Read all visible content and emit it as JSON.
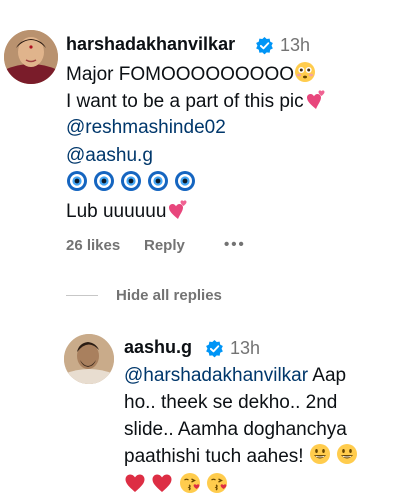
{
  "comment": {
    "username": "harshadakhanvilkar",
    "time": "13h",
    "line1": "Major FOMOOOOOOOOO",
    "line1_emoji": "flushed-face-icon",
    "line2": "I want to be a part of this pic",
    "line2_emoji": "two-hearts-icon",
    "mention1": "@reshmashinde02",
    "mention2": "@aashu.g",
    "line5_emoji": "nazar-amulet-icon x5",
    "line6": "Lub uuuuuu",
    "line6_emoji": "two-hearts-icon",
    "likes": "26 likes",
    "reply_label": "Reply",
    "more_label": "•••"
  },
  "replies_toggle": {
    "label": "Hide all replies"
  },
  "reply": {
    "username": "aashu.g",
    "time": "13h",
    "mention": "@harshadakhanvilkar",
    "text1": " Aap",
    "text2": "ho.. theek se dekho.. 2nd",
    "text3": "slide.. Aamha doghanchya",
    "text4": "paathishi tuch aahes!",
    "emojis_line1": "grinning-face-icon x2",
    "emojis_line2": "red-heart-icon x2, face-blowing-kiss-icon x2"
  },
  "colors": {
    "mention": "#00376b",
    "verified": "#0095f6",
    "muted": "#737373"
  }
}
